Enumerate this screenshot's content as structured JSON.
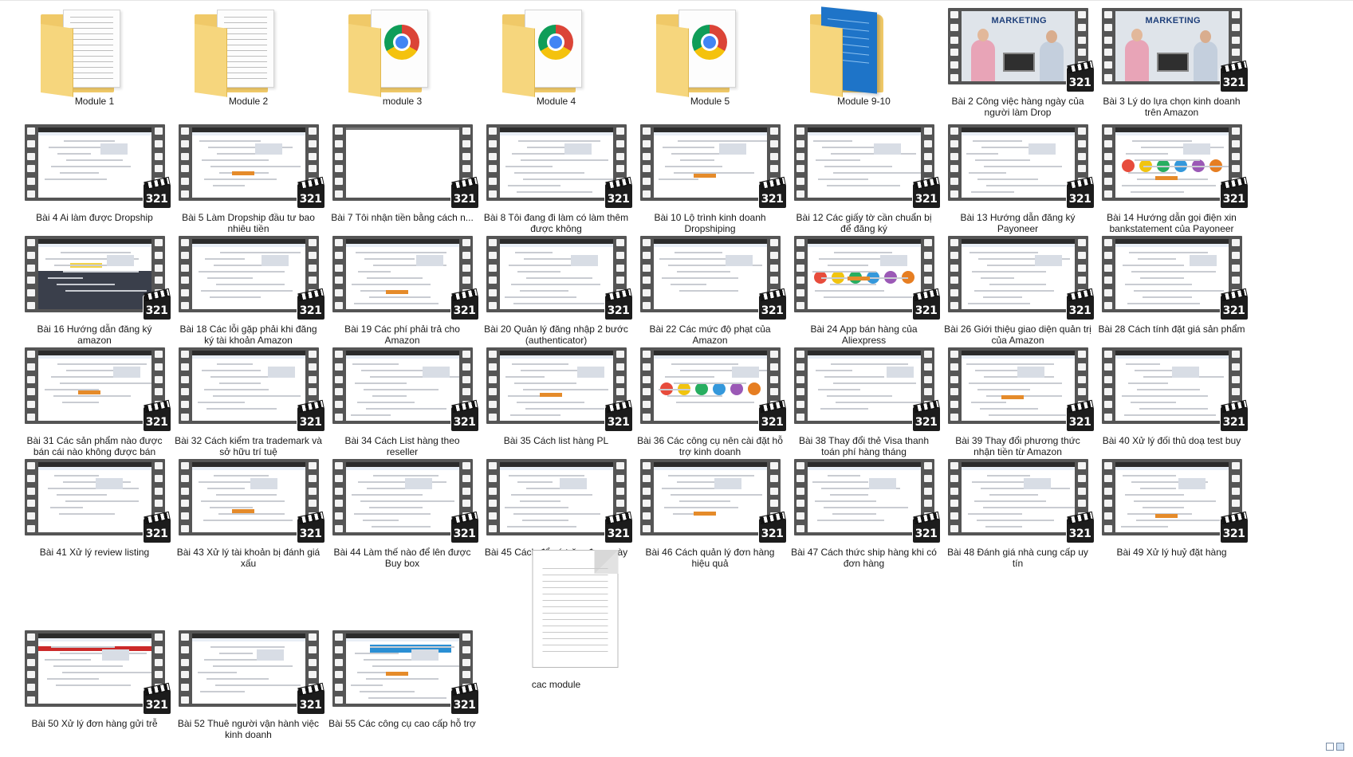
{
  "colors": {
    "folder": "#f0c968",
    "film": "#555555",
    "background": "#ffffff"
  },
  "items": [
    {
      "type": "folder-doc",
      "label": "Module 1",
      "icon": "folder-icon"
    },
    {
      "type": "folder-doc",
      "label": "Module 2",
      "icon": "folder-icon"
    },
    {
      "type": "folder-chrome",
      "label": "module 3",
      "icon": "folder-chrome-icon"
    },
    {
      "type": "folder-chrome",
      "label": "Module 4",
      "icon": "folder-chrome-icon"
    },
    {
      "type": "folder-chrome",
      "label": "Module 5",
      "icon": "folder-chrome-icon"
    },
    {
      "type": "folder-blue",
      "label": "Module 9-10",
      "icon": "folder-icon"
    },
    {
      "type": "video-marketing",
      "label": "Bài 2 Công việc hàng ngày của người làm Drop",
      "badge": "321",
      "overlay": "MARKETING"
    },
    {
      "type": "video-marketing",
      "label": "Bài 3 Lý do lựa chọn kinh doanh trên Amazon",
      "badge": "321",
      "overlay": "MARKETING"
    },
    {
      "type": "video",
      "label": "Bài 4 Ai làm được Dropship",
      "badge": "321"
    },
    {
      "type": "video",
      "label": "Bài 5 Làm Dropship đầu tư bao nhiêu tiền",
      "badge": "321"
    },
    {
      "type": "video-blank",
      "label": "Bài 7 Tôi nhận tiền bằng cách n...",
      "badge": "321"
    },
    {
      "type": "video",
      "label": "Bài 8 Tôi đang đi làm có làm thêm được không",
      "badge": "321"
    },
    {
      "type": "video",
      "label": "Bài 10 Lộ trình kinh doanh Dropshiping",
      "badge": "321"
    },
    {
      "type": "video",
      "label": "Bài 12 Các giấy tờ cần chuẩn bị để đăng ký",
      "badge": "321"
    },
    {
      "type": "video",
      "label": "Bài 13 Hướng dẫn đăng ký Payoneer",
      "badge": "321"
    },
    {
      "type": "video-color",
      "label": "Bài 14 Hướng dẫn gọi điện xin bankstatement của Payoneer",
      "badge": "321"
    },
    {
      "type": "video-dark",
      "label": "Bài 16 Hướng dẫn đăng ký amazon",
      "badge": "321"
    },
    {
      "type": "video",
      "label": "Bài 18 Các lỗi gặp phải khi đăng ký tài khoản Amazon",
      "badge": "321"
    },
    {
      "type": "video",
      "label": "Bài 19 Các phí phải trả cho Amazon",
      "badge": "321"
    },
    {
      "type": "video",
      "label": "Bài 20 Quản lý đăng nhập 2 bước (authenticator)",
      "badge": "321"
    },
    {
      "type": "video",
      "label": "Bài 22 Các mức độ phạt của Amazon",
      "badge": "321"
    },
    {
      "type": "video-color",
      "label": "Bài 24 App bán hàng của Aliexpress",
      "badge": "321"
    },
    {
      "type": "video",
      "label": "Bài 26 Giới thiệu giao diện quản trị của Amazon",
      "badge": "321"
    },
    {
      "type": "video",
      "label": "Bài 28 Cách tính đặt giá sản phẩm",
      "badge": "321"
    },
    {
      "type": "video",
      "label": "Bài 31 Các sản phẩm nào được bán cái nào không được bán",
      "badge": "321"
    },
    {
      "type": "video",
      "label": "Bài 32 Cách kiểm tra trademark và sở hữu trí tuệ",
      "badge": "321"
    },
    {
      "type": "video",
      "label": "Bài 34 Cách List hàng theo reseller",
      "badge": "321"
    },
    {
      "type": "video",
      "label": "Bài 35 Cách list hàng PL",
      "badge": "321"
    },
    {
      "type": "video-color",
      "label": "Bài 36 Các công cụ nên cài đặt hỗ trợ kinh doanh",
      "badge": "321"
    },
    {
      "type": "video",
      "label": "Bài 38 Thay đổi thẻ Visa thanh toán phí hàng tháng",
      "badge": "321"
    },
    {
      "type": "video",
      "label": "Bài 39 Thay đổi phương thức nhận tiền từ Amazon",
      "badge": "321"
    },
    {
      "type": "video",
      "label": "Bài 40 Xử lý đối thủ doạ test buy",
      "badge": "321"
    },
    {
      "type": "video",
      "label": "Bài 41 Xử lý review listing",
      "badge": "321"
    },
    {
      "type": "video",
      "label": "Bài 43 Xử lý tài khoản bị đánh giá xấu",
      "badge": "321"
    },
    {
      "type": "video",
      "label": "Bài 44 Làm thế nào để lên được Buy box",
      "badge": "321"
    },
    {
      "type": "video",
      "label": "Bài 45 Cách để có trăm đơn  ngày",
      "badge": "321"
    },
    {
      "type": "video",
      "label": "Bài 46 Cách quản lý đơn hàng hiệu quả",
      "badge": "321"
    },
    {
      "type": "video",
      "label": "Bài 47 Cách thức ship hàng khi có đơn hàng",
      "badge": "321"
    },
    {
      "type": "video",
      "label": "Bài 48 Đánh giá nhà cung cấp uy tín",
      "badge": "321"
    },
    {
      "type": "video",
      "label": "Bài 49 Xử lý huỷ đặt hàng",
      "badge": "321"
    },
    {
      "type": "video-red",
      "label": "Bài 50 Xử lý đơn hàng gửi trễ",
      "badge": "321"
    },
    {
      "type": "video",
      "label": "Bài 52 Thuê người vận hành việc kinh doanh",
      "badge": "321"
    },
    {
      "type": "video-blue",
      "label": "Bài 55 Các công cụ cao cấp hỗ trợ",
      "badge": "321"
    },
    {
      "type": "doc",
      "label": "cac module",
      "icon": "text-file-icon"
    }
  ]
}
